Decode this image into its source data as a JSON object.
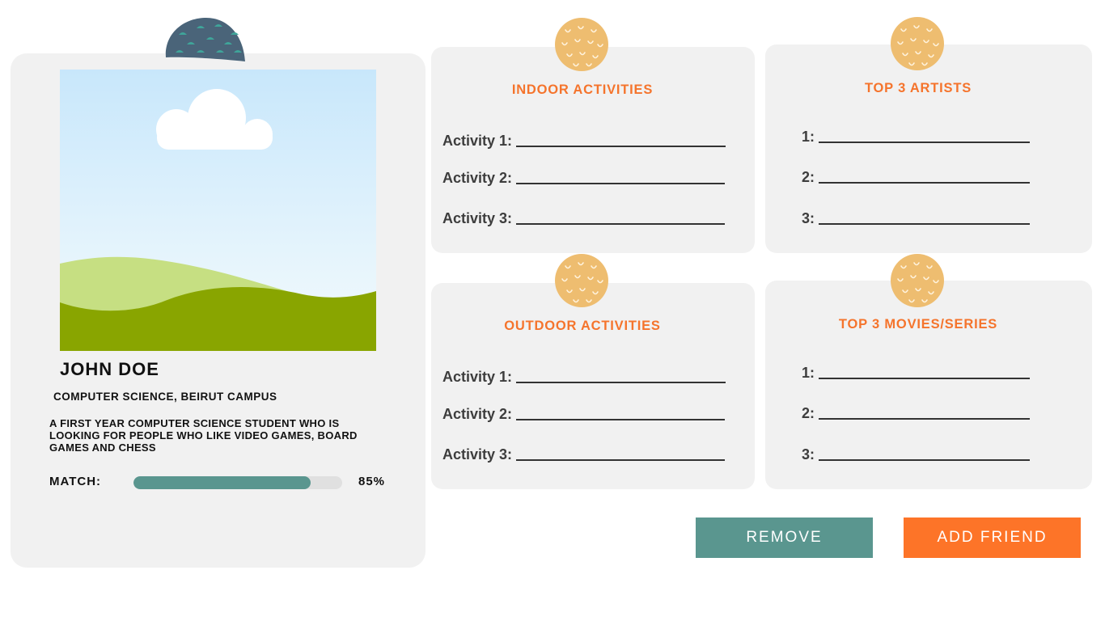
{
  "profile": {
    "name": "JOHN DOE",
    "program": "COMPUTER SCIENCE, BEIRUT CAMPUS",
    "bio": "A FIRST YEAR COMPUTER SCIENCE STUDENT WHO IS LOOKING FOR PEOPLE WHO LIKE VIDEO GAMES, BOARD GAMES AND CHESS",
    "match_label": "MATCH:",
    "match_value": "85%",
    "match_fraction": 0.85
  },
  "indoor": {
    "title": "INDOOR ACTIVITIES",
    "fields": [
      "Activity 1:",
      "Activity 2:",
      "Activity 3:"
    ]
  },
  "outdoor": {
    "title": "OUTDOOR ACTIVITIES",
    "fields": [
      "Activity 1:",
      "Activity 2:",
      "Activity 3:"
    ]
  },
  "artists": {
    "title": "TOP 3 ARTISTS",
    "fields": [
      "1:",
      "2:",
      "3:"
    ]
  },
  "movies": {
    "title": "TOP 3 MOVIES/SERIES",
    "fields": [
      "1:",
      "2:",
      "3:"
    ]
  },
  "actions": {
    "remove_label": "REMOVE",
    "add_friend_label": "ADD FRIEND"
  },
  "colors": {
    "accent_orange": "#f5742c",
    "teal": "#5a968f",
    "card_bg": "#f1f1f1",
    "pin_orange": "#eebd70",
    "pin_dark": "#4a6479"
  }
}
